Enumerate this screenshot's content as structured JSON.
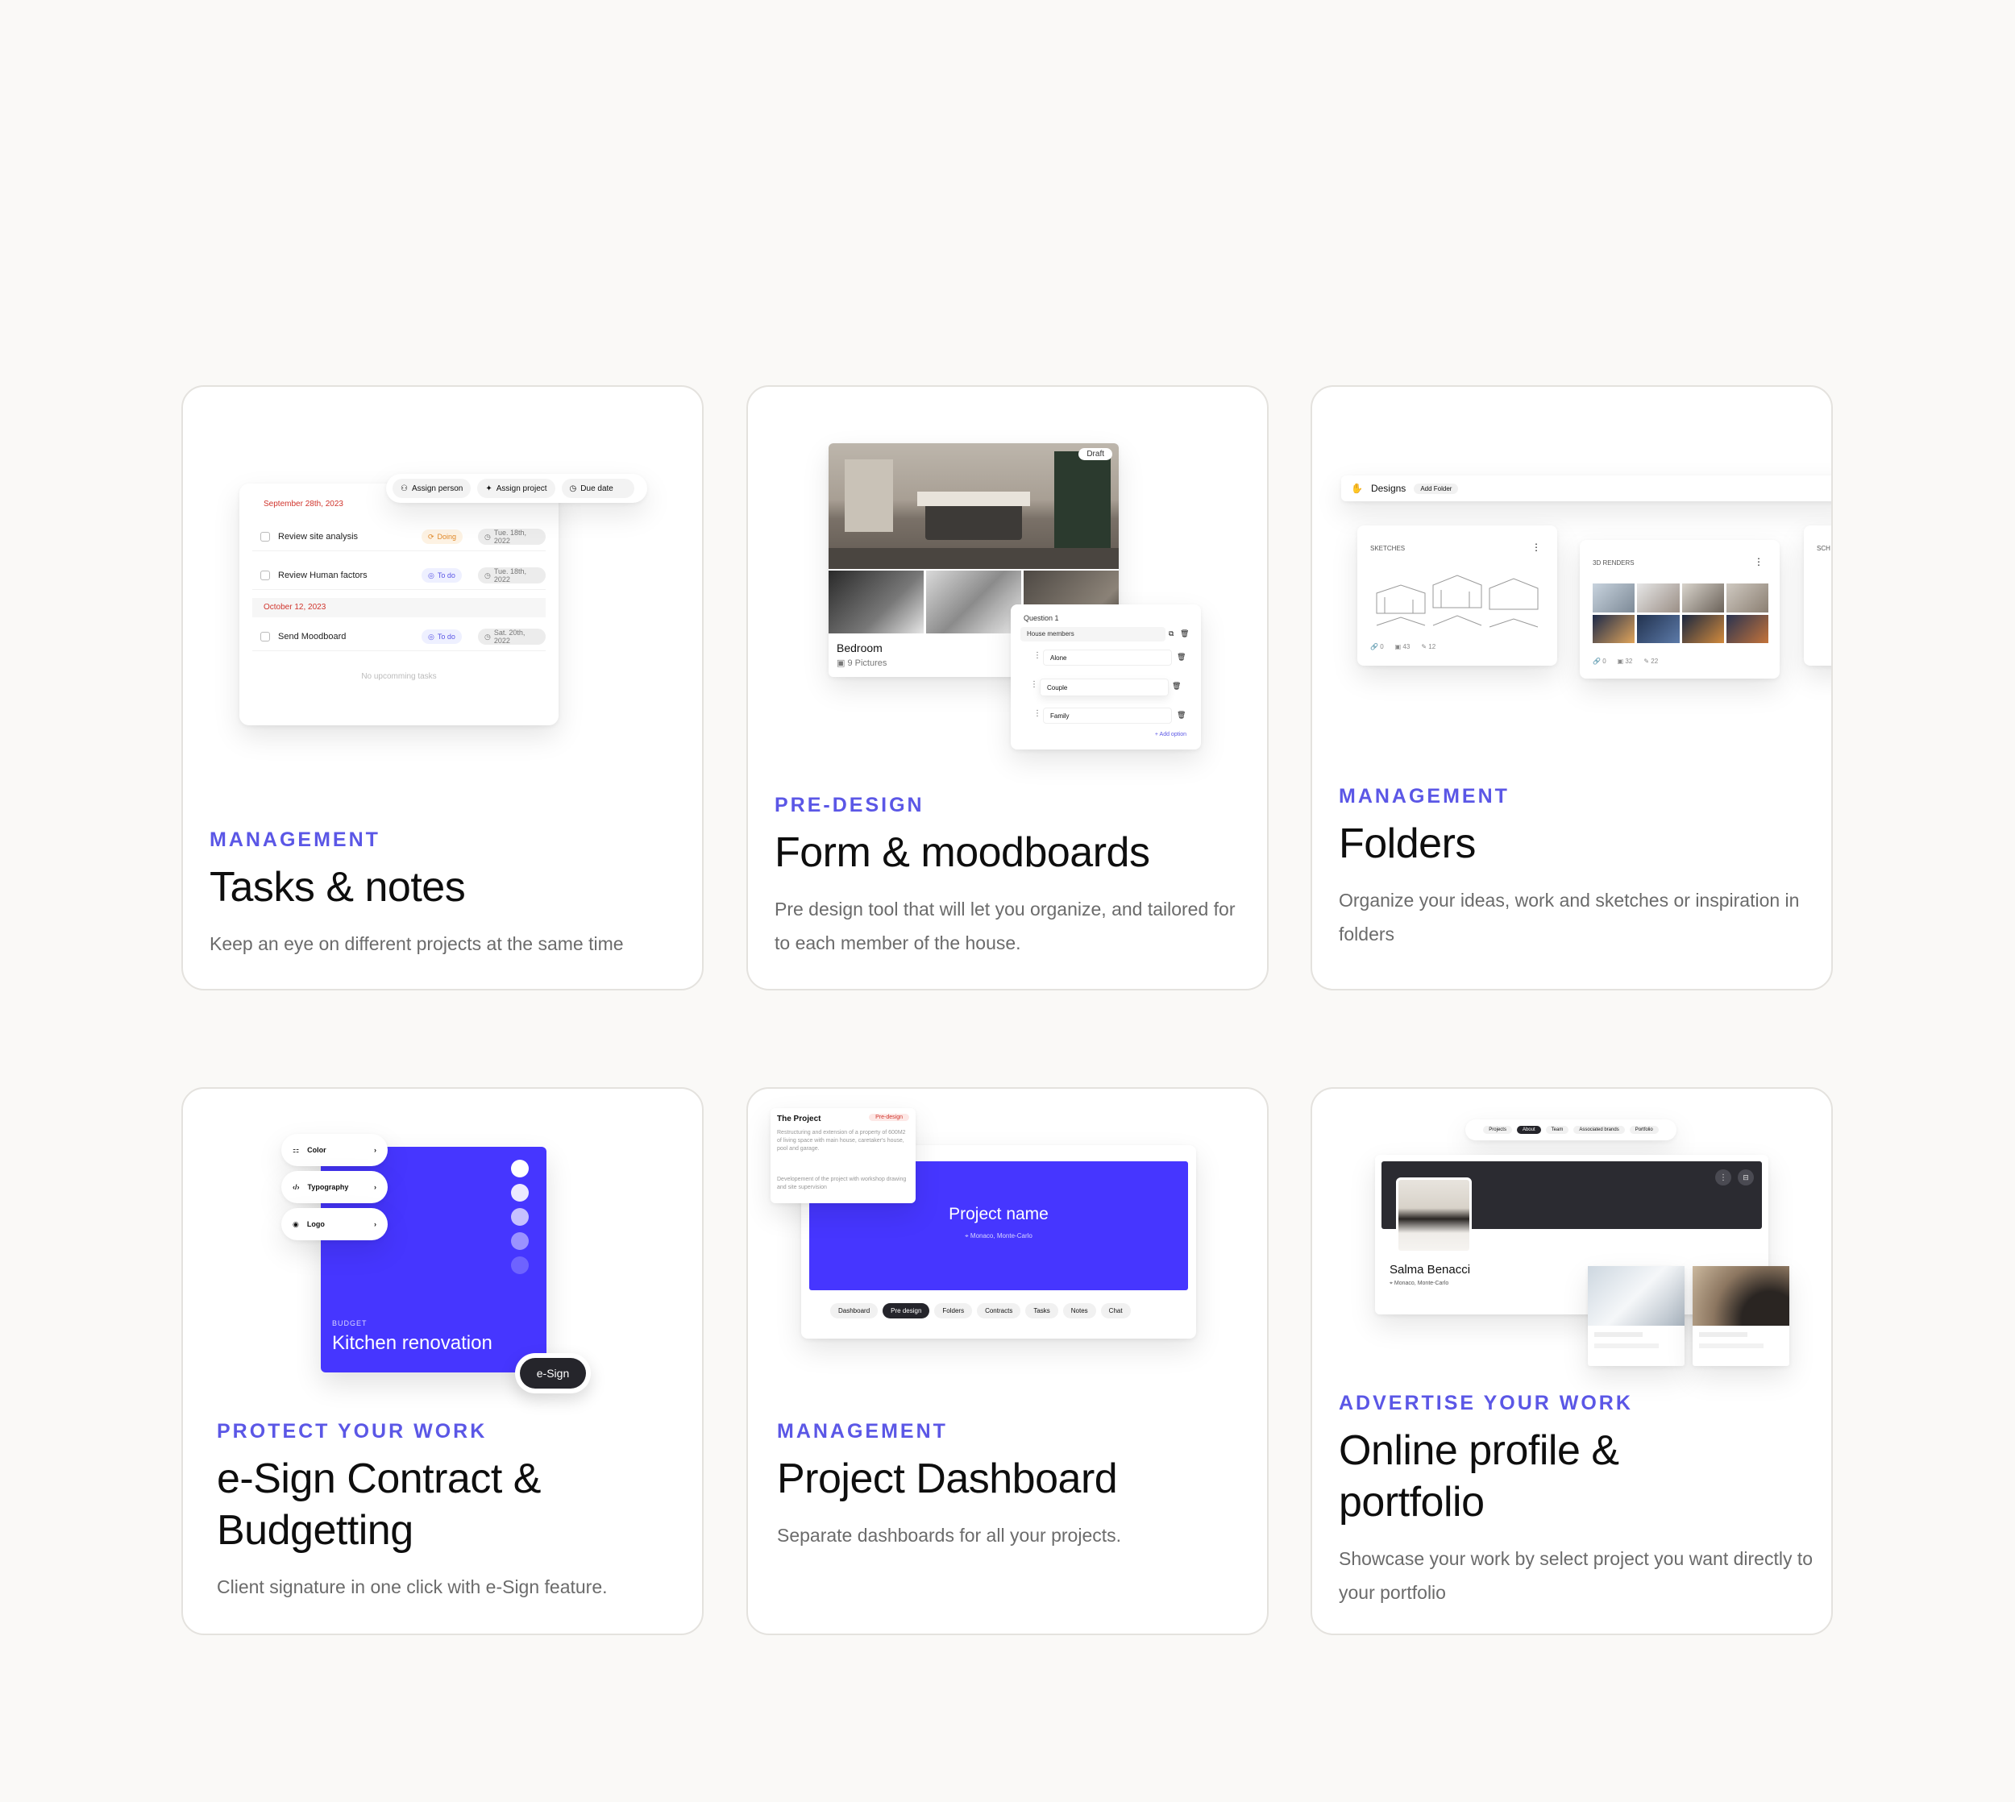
{
  "cards": {
    "tasks": {
      "eyebrow": "MANAGEMENT",
      "title": "Tasks & notes",
      "description": "Keep an eye on different projects at the same time",
      "mock": {
        "toolbar": [
          "Assign person",
          "Assign project",
          "Due date"
        ],
        "group1_date": "September 28th, 2023",
        "group2_date": "October 12, 2023",
        "tasks": [
          {
            "label": "Review site analysis",
            "status": "Doing",
            "date": "Tue. 18th, 2022"
          },
          {
            "label": "Review Human factors",
            "status": "To do",
            "date": "Tue. 18th, 2022"
          },
          {
            "label": "Send Moodboard",
            "status": "To do",
            "date": "Sat. 20th, 2022"
          }
        ],
        "empty": "No upcomming tasks"
      }
    },
    "form": {
      "eyebrow": "PRE-DESIGN",
      "title": "Form & moodboards",
      "description": "Pre design tool that will let you organize, and tailored for to each member of the house.",
      "mock": {
        "draft": "Draft",
        "room": "Bedroom",
        "pictures": "9 Pictures",
        "question": "Question 1",
        "question_field": "House members",
        "options": [
          "Alone",
          "Couple",
          "Family"
        ],
        "add_option": "+ Add option"
      }
    },
    "folders": {
      "eyebrow": "MANAGEMENT",
      "title": "Folders",
      "description": "Organize your ideas, work and sketches or inspiration in folders",
      "mock": {
        "section": "Designs",
        "add_folder": "Add Folder",
        "folders": [
          {
            "name": "SKETCHES",
            "stats": [
              "0",
              "43",
              "12"
            ]
          },
          {
            "name": "3D RENDERS",
            "stats": [
              "0",
              "32",
              "22"
            ]
          },
          {
            "name": "SCH",
            "stats": []
          }
        ]
      }
    },
    "esign": {
      "eyebrow": "PROTECT YOUR WORK",
      "title": "e-Sign Contract & Budgetting",
      "description": "Client signature in one click with e-Sign feature.",
      "mock": {
        "menu": [
          "Color",
          "Typography",
          "Logo"
        ],
        "budget_label": "BUDGET",
        "project": "Kitchen renovation",
        "esign_button": "e-Sign"
      }
    },
    "dashboard": {
      "eyebrow": "MANAGEMENT",
      "title": "Project Dashboard",
      "description": "Separate dashboards for all your projects.",
      "mock": {
        "project_card_title": "The Project",
        "project_card_badge": "Pre-design",
        "project_card_text1": "Restructuring and extension of a property of 600M2 of living space with main house, caretaker's house, pool and garage.",
        "project_card_text2": "Developement of the project with workshop drawing and site supervision",
        "project_name": "Project name",
        "location": "Monaco, Monte-Carlo",
        "tabs": [
          "Dashboard",
          "Pre design",
          "Folders",
          "Contracts",
          "Tasks",
          "Notes",
          "Chat"
        ],
        "active_tab": "Pre design"
      }
    },
    "profile": {
      "eyebrow": "ADVERTISE YOUR WORK",
      "title": "Online profile & portfolio",
      "description": "Showcase your work by select project you want directly to your portfolio",
      "mock": {
        "tabs": [
          "Projects",
          "About",
          "Team",
          "Associated brands",
          "Portfolio"
        ],
        "active_tab": "About",
        "name": "Salma Benacci",
        "location": "Monaco, Monte-Carlo"
      }
    }
  },
  "colors": {
    "accent": "#5b57e6",
    "brand_blue": "#4636ff",
    "page_bg": "#faf9f7",
    "dark": "#2a2a30",
    "red_date": "#d0342c"
  }
}
